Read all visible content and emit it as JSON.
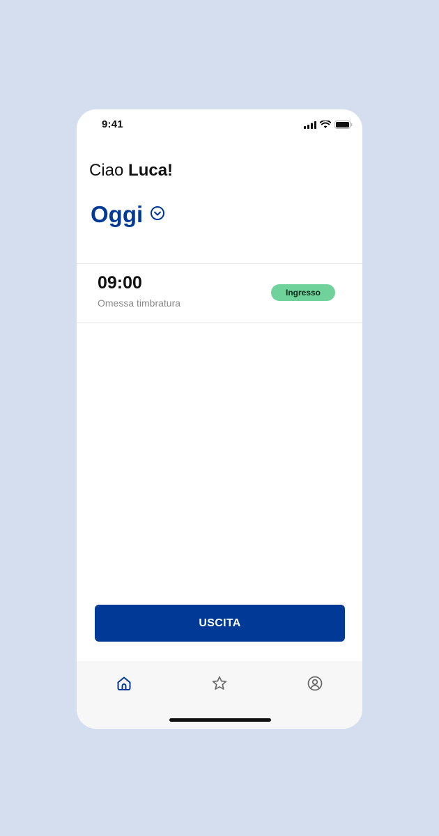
{
  "status_bar": {
    "time": "9:41"
  },
  "greeting": {
    "prefix": "Ciao ",
    "name": "Luca!"
  },
  "day_selector": {
    "label": "Oggi",
    "icon": "chevron-down-circle-icon"
  },
  "entries": [
    {
      "time": "09:00",
      "subtitle": "Omessa timbratura",
      "badge": "Ingresso"
    }
  ],
  "action_button": {
    "label": "USCITA"
  },
  "tabbar": {
    "items": [
      {
        "icon": "home-icon",
        "active": true
      },
      {
        "icon": "star-icon",
        "active": false
      },
      {
        "icon": "profile-icon",
        "active": false
      }
    ]
  },
  "colors": {
    "background": "#d5deee",
    "primary": "#003a96",
    "badge": "#6ed29a",
    "tabbar": "#f7f7f7",
    "inactive_icon": "#6b6b6b"
  }
}
